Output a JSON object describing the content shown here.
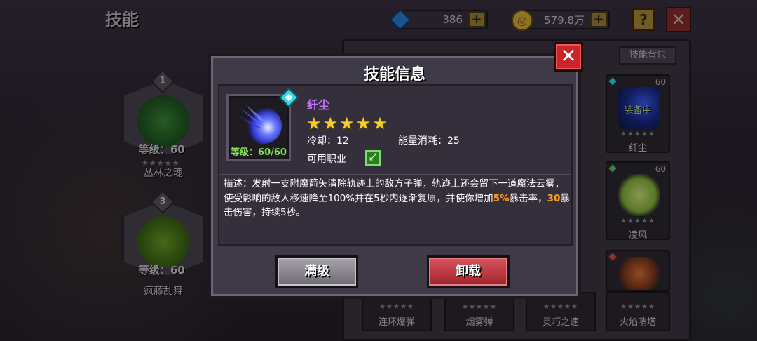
{
  "header": {
    "title": "技能",
    "gems": "386",
    "coins": "579.8万",
    "help_label": "?",
    "close_label": "✕"
  },
  "left_slots": [
    {
      "number": "1",
      "level": "等级：60",
      "stars": "★★★★★",
      "name": "丛林之魂"
    },
    {
      "number": "3",
      "level": "等级：60",
      "stars": "★★★★★",
      "name": "疯藤乱舞"
    }
  ],
  "right_panel": {
    "bag_tab": "技能背包",
    "cards": [
      {
        "level": "60",
        "stars": "★★★★★",
        "name": "纤尘",
        "equipped": "装备中"
      },
      {
        "level": "60",
        "stars": "★★★★★",
        "name": "凌风"
      }
    ],
    "bottom_cards": [
      {
        "stars": "★★★★★",
        "name": "连环爆弹"
      },
      {
        "stars": "★★★★★",
        "name": "烟雾弹"
      },
      {
        "stars": "★★★★★",
        "name": "灵巧之速"
      },
      {
        "stars": "★★★★★",
        "name": "火焰哨塔"
      }
    ]
  },
  "modal": {
    "title": "技能信息",
    "close_label": "✕",
    "skill": {
      "name": "纤尘",
      "stars": "★★★★★",
      "level": "等级：60/60",
      "cooldown": "冷却：12",
      "energy": "能量消耗：25",
      "job_label": "可用职业"
    },
    "description": {
      "part1": "描述：发射一支附魔箭矢清除轨迹上的敌方子弹，轨迹上还会留下一道魔法云雾，使受影响的敌人移速降至100%并在5秒内逐渐复原，并使你增加",
      "hl1": "5%",
      "part2": "暴击率，",
      "hl2": "30",
      "part3": "暴击伤害，持续5秒。"
    },
    "buttons": {
      "max_label": "满级",
      "unload_label": "卸载"
    }
  }
}
